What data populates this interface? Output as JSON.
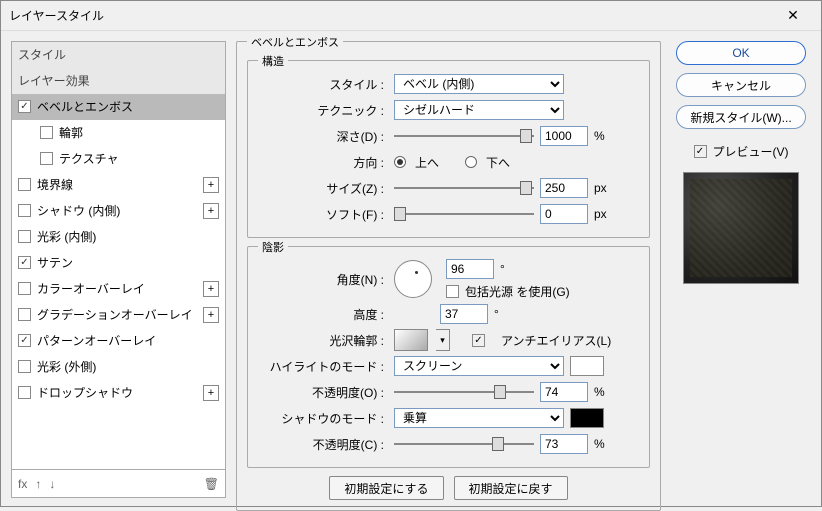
{
  "title": "レイヤースタイル",
  "close": "✕",
  "left": {
    "header_style": "スタイル",
    "header_effects": "レイヤー効果",
    "items": [
      {
        "label": "ベベルとエンボス",
        "checked": true,
        "selected": true
      },
      {
        "label": "輪郭",
        "checked": false,
        "sub": true
      },
      {
        "label": "テクスチャ",
        "checked": false,
        "sub": true
      },
      {
        "label": "境界線",
        "checked": false,
        "add": true
      },
      {
        "label": "シャドウ (内側)",
        "checked": false,
        "add": true
      },
      {
        "label": "光彩 (内側)",
        "checked": false
      },
      {
        "label": "サテン",
        "checked": true
      },
      {
        "label": "カラーオーバーレイ",
        "checked": false,
        "add": true
      },
      {
        "label": "グラデーションオーバーレイ",
        "checked": false,
        "add": true
      },
      {
        "label": "パターンオーバーレイ",
        "checked": true
      },
      {
        "label": "光彩 (外側)",
        "checked": false
      },
      {
        "label": "ドロップシャドウ",
        "checked": false,
        "add": true
      }
    ],
    "footer_fx": "fx"
  },
  "panel": {
    "legend": "ベベルとエンボス",
    "struct_legend": "構造",
    "style_label": "スタイル :",
    "style_value": "ベベル (内側)",
    "tech_label": "テクニック :",
    "tech_value": "シゼルハード",
    "depth_label": "深さ(D) :",
    "depth_value": "1000",
    "depth_unit": "%",
    "dir_label": "方向 :",
    "dir_up": "上へ",
    "dir_down": "下へ",
    "size_label": "サイズ(Z) :",
    "size_value": "250",
    "size_unit": "px",
    "soft_label": "ソフト(F) :",
    "soft_value": "0",
    "soft_unit": "px",
    "shade_legend": "陰影",
    "angle_label": "角度(N) :",
    "angle_value": "96",
    "deg": "°",
    "global_label": "包括光源 を使用(G)",
    "alt_label": "高度 :",
    "alt_value": "37",
    "gloss_label": "光沢輪郭 :",
    "aa_label": "アンチエイリアス(L)",
    "hl_mode_label": "ハイライトのモード :",
    "hl_mode_value": "スクリーン",
    "hl_op_label": "不透明度(O) :",
    "hl_op_value": "74",
    "pct": "%",
    "sh_mode_label": "シャドウのモード :",
    "sh_mode_value": "乗算",
    "sh_op_label": "不透明度(C) :",
    "sh_op_value": "73",
    "make_default": "初期設定にする",
    "reset_default": "初期設定に戻す"
  },
  "right": {
    "ok": "OK",
    "cancel": "キャンセル",
    "new_style": "新規スタイル(W)...",
    "preview": "プレビュー(V)"
  }
}
